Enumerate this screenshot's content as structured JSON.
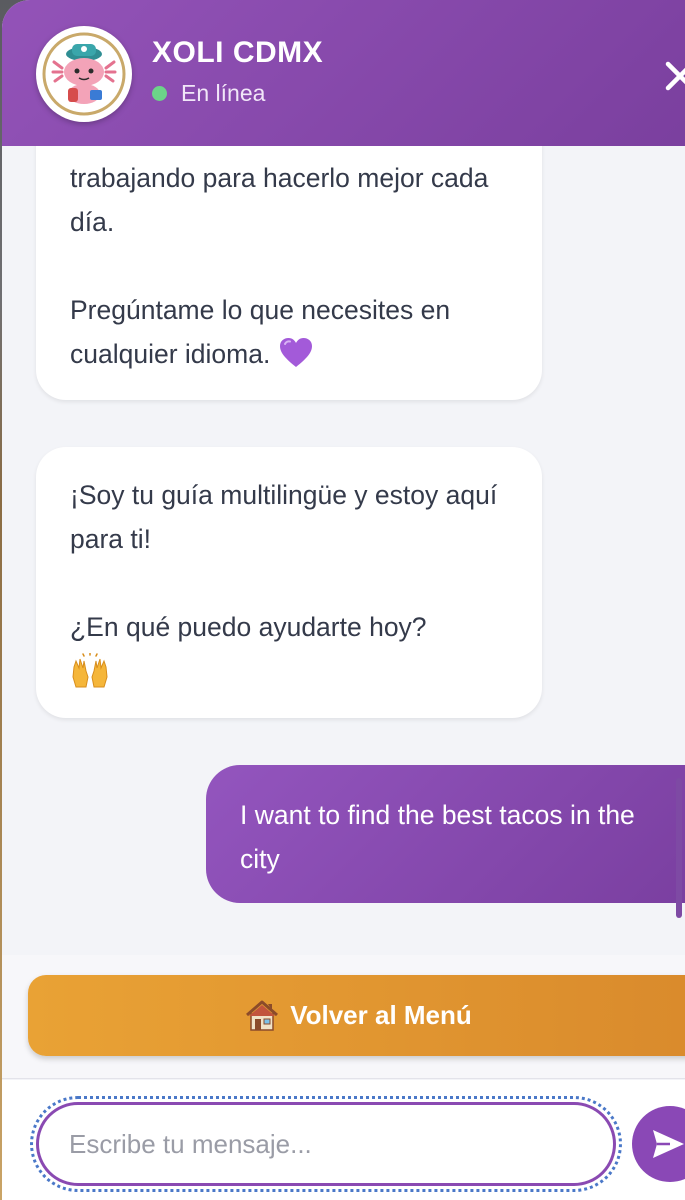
{
  "header": {
    "title": "XOLI CDMX",
    "status": "En línea",
    "avatar_icon": "axolotl-mascot-icon",
    "close_icon": "close-icon"
  },
  "messages": [
    {
      "role": "bot",
      "paragraphs": [
        "trabajando para hacerlo mejor cada día.",
        "Pregúntame lo que necesites en cualquier idioma."
      ],
      "trailing_emoji": "purple-heart-icon"
    },
    {
      "role": "bot",
      "paragraphs": [
        "¡Soy tu guía multilingüe y estoy aquí para ti!",
        "¿En qué puedo ayudarte hoy?"
      ],
      "trailing_emoji": "raising-hands-icon"
    },
    {
      "role": "user",
      "text": "I want to find the best tacos in the city"
    }
  ],
  "menu_button": {
    "label": "Volver al Menú",
    "icon": "house-icon"
  },
  "input": {
    "placeholder": "Escribe tu mensaje...",
    "value": ""
  },
  "send_button": {
    "icon": "send-icon"
  },
  "colors": {
    "header_purple": "#8a48b6",
    "status_green": "#6cd389",
    "menu_orange": "#e3952f",
    "chat_background": "#f3f4f8"
  }
}
